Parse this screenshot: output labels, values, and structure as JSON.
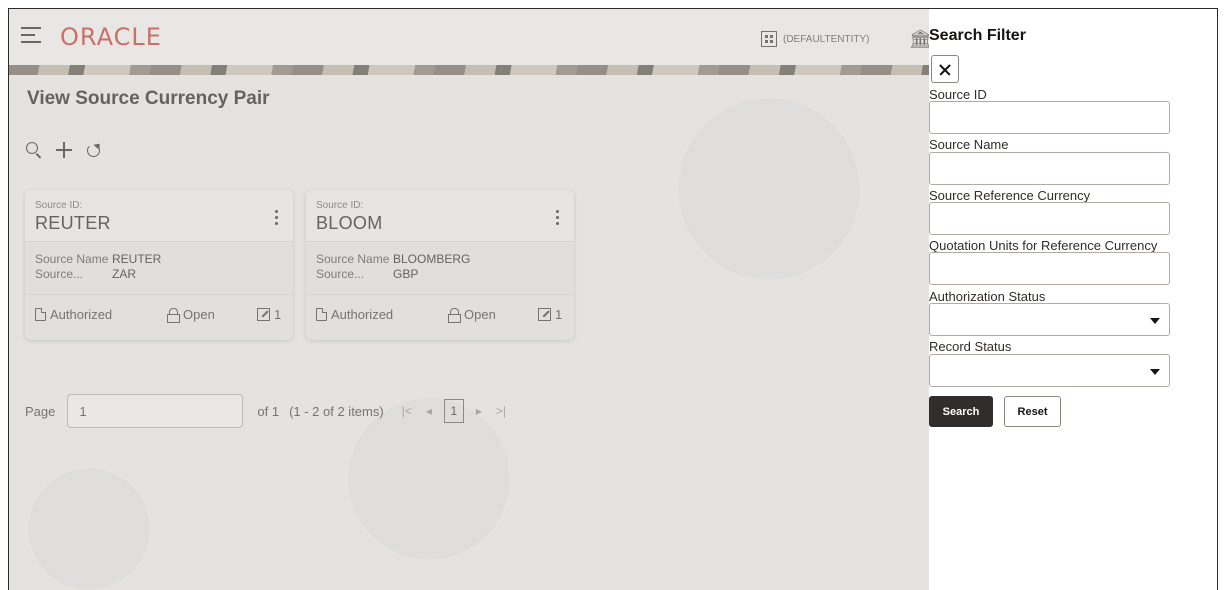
{
  "header": {
    "logo": "ORACLE",
    "entity": "(DEFAULTENTITY)",
    "icons": [
      "hamburger-icon",
      "building-icon",
      "bank-icon"
    ]
  },
  "page": {
    "title": "View Source Currency Pair"
  },
  "toolbar": {
    "icons": [
      "search-icon",
      "plus-icon",
      "refresh-icon"
    ]
  },
  "cards": [
    {
      "id_label": "Source ID:",
      "id": "REUTER",
      "rows": [
        {
          "key": "Source Name",
          "value": "REUTER"
        },
        {
          "key": "Source...",
          "value": "ZAR"
        }
      ],
      "auth": "Authorized",
      "record": "Open",
      "mod_count": "1"
    },
    {
      "id_label": "Source ID:",
      "id": "BLOOM",
      "rows": [
        {
          "key": "Source Name",
          "value": "BLOOMBERG"
        },
        {
          "key": "Source...",
          "value": "GBP"
        }
      ],
      "auth": "Authorized",
      "record": "Open",
      "mod_count": "1"
    }
  ],
  "pagination": {
    "label": "Page",
    "value": "1",
    "of_text": "of 1",
    "count_text": "(1 - 2 of 2 items)",
    "first": "|<",
    "prev": "◂",
    "current": "1",
    "next": "▸",
    "last": ">|"
  },
  "filter": {
    "title": "Search Filter",
    "fields": [
      {
        "label": "Source ID",
        "type": "text"
      },
      {
        "label": "Source Name",
        "type": "text"
      },
      {
        "label": "Source Reference Currency",
        "type": "text"
      },
      {
        "label": "Quotation Units for Reference Currency",
        "type": "text"
      },
      {
        "label": "Authorization Status",
        "type": "select"
      },
      {
        "label": "Record Status",
        "type": "select"
      }
    ],
    "search_label": "Search",
    "reset_label": "Reset"
  },
  "colors": {
    "brand": "#c74634",
    "primary_button": "#312d2a"
  }
}
